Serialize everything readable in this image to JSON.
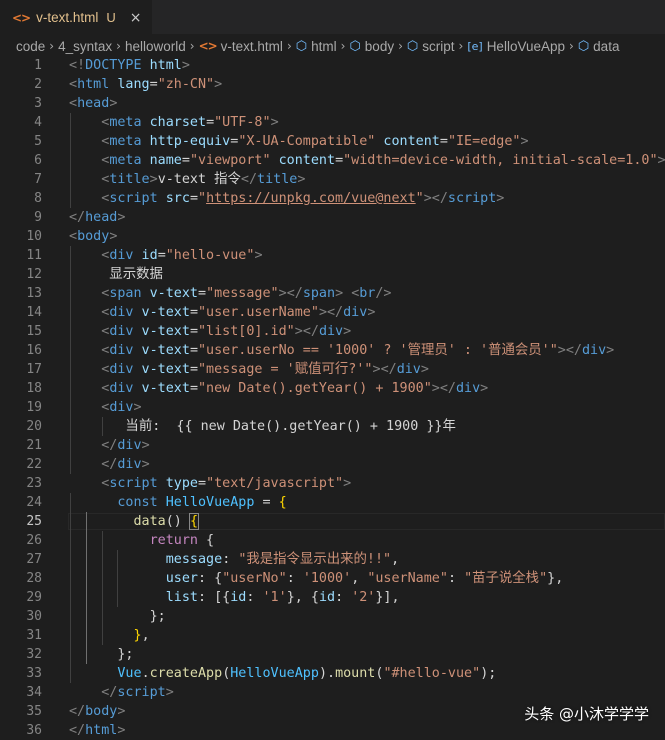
{
  "tab": {
    "icon": "html-file-icon",
    "title": "v-text.html",
    "badge": "U",
    "close": "×"
  },
  "breadcrumb": [
    {
      "label": "code",
      "icon": null
    },
    {
      "label": "4_syntax",
      "icon": null
    },
    {
      "label": "helloworld",
      "icon": null
    },
    {
      "label": "v-text.html",
      "icon": "html-file-icon"
    },
    {
      "label": "html",
      "icon": "element-icon"
    },
    {
      "label": "body",
      "icon": "element-icon"
    },
    {
      "label": "script",
      "icon": "element-icon"
    },
    {
      "label": "HelloVueApp",
      "icon": "variable-icon"
    },
    {
      "label": "data",
      "icon": "element-icon"
    }
  ],
  "editor": {
    "active_line": 25,
    "lines": [
      {
        "n": "1",
        "tokens": [
          [
            "punc",
            "<!"
          ],
          [
            "tag",
            "DOCTYPE"
          ],
          [
            "attr",
            " html"
          ],
          [
            "punc",
            ">"
          ]
        ]
      },
      {
        "n": "2",
        "tokens": [
          [
            "punc",
            "<"
          ],
          [
            "tag",
            "html"
          ],
          [
            "attr",
            " lang"
          ],
          [
            "txt",
            "="
          ],
          [
            "str",
            "\"zh-CN\""
          ],
          [
            "punc",
            ">"
          ]
        ]
      },
      {
        "n": "3",
        "tokens": [
          [
            "punc",
            "<"
          ],
          [
            "tag",
            "head"
          ],
          [
            "punc",
            ">"
          ]
        ]
      },
      {
        "n": "4",
        "tokens": [
          [
            "txt",
            "    "
          ],
          [
            "punc",
            "<"
          ],
          [
            "tag",
            "meta"
          ],
          [
            "attr",
            " charset"
          ],
          [
            "txt",
            "="
          ],
          [
            "str",
            "\"UTF-8\""
          ],
          [
            "punc",
            ">"
          ]
        ]
      },
      {
        "n": "5",
        "tokens": [
          [
            "txt",
            "    "
          ],
          [
            "punc",
            "<"
          ],
          [
            "tag",
            "meta"
          ],
          [
            "attr",
            " http-equiv"
          ],
          [
            "txt",
            "="
          ],
          [
            "str",
            "\"X-UA-Compatible\""
          ],
          [
            "attr",
            " content"
          ],
          [
            "txt",
            "="
          ],
          [
            "str",
            "\"IE=edge\""
          ],
          [
            "punc",
            ">"
          ]
        ]
      },
      {
        "n": "6",
        "tokens": [
          [
            "txt",
            "    "
          ],
          [
            "punc",
            "<"
          ],
          [
            "tag",
            "meta"
          ],
          [
            "attr",
            " name"
          ],
          [
            "txt",
            "="
          ],
          [
            "str",
            "\"viewport\""
          ],
          [
            "attr",
            " content"
          ],
          [
            "txt",
            "="
          ],
          [
            "str",
            "\"width=device-width, initial-scale=1.0\""
          ],
          [
            "punc",
            ">"
          ]
        ]
      },
      {
        "n": "7",
        "tokens": [
          [
            "txt",
            "    "
          ],
          [
            "punc",
            "<"
          ],
          [
            "tag",
            "title"
          ],
          [
            "punc",
            ">"
          ],
          [
            "txt",
            "v-text 指令"
          ],
          [
            "punc",
            "</"
          ],
          [
            "tag",
            "title"
          ],
          [
            "punc",
            ">"
          ]
        ]
      },
      {
        "n": "8",
        "tokens": [
          [
            "txt",
            "    "
          ],
          [
            "punc",
            "<"
          ],
          [
            "tag",
            "script"
          ],
          [
            "attr",
            " src"
          ],
          [
            "txt",
            "="
          ],
          [
            "str",
            "\""
          ],
          [
            "url",
            "https://unpkg.com/vue@next"
          ],
          [
            "str",
            "\""
          ],
          [
            "punc",
            ">"
          ],
          [
            "punc",
            "</"
          ],
          [
            "tag",
            "script"
          ],
          [
            "punc",
            ">"
          ]
        ]
      },
      {
        "n": "9",
        "tokens": [
          [
            "punc",
            "</"
          ],
          [
            "tag",
            "head"
          ],
          [
            "punc",
            ">"
          ]
        ]
      },
      {
        "n": "10",
        "tokens": [
          [
            "punc",
            "<"
          ],
          [
            "tag",
            "body"
          ],
          [
            "punc",
            ">"
          ]
        ]
      },
      {
        "n": "11",
        "tokens": [
          [
            "txt",
            "    "
          ],
          [
            "punc",
            "<"
          ],
          [
            "tag",
            "div"
          ],
          [
            "attr",
            " id"
          ],
          [
            "txt",
            "="
          ],
          [
            "str",
            "\"hello-vue\""
          ],
          [
            "punc",
            ">"
          ]
        ]
      },
      {
        "n": "12",
        "tokens": [
          [
            "txt",
            "     显示数据"
          ]
        ]
      },
      {
        "n": "13",
        "tokens": [
          [
            "txt",
            "    "
          ],
          [
            "punc",
            "<"
          ],
          [
            "tag",
            "span"
          ],
          [
            "attr",
            " v-text"
          ],
          [
            "txt",
            "="
          ],
          [
            "str",
            "\"message\""
          ],
          [
            "punc",
            ">"
          ],
          [
            "punc",
            "</"
          ],
          [
            "tag",
            "span"
          ],
          [
            "punc",
            ">"
          ],
          [
            "txt",
            " "
          ],
          [
            "punc",
            "<"
          ],
          [
            "tag",
            "br"
          ],
          [
            "punc",
            "/>"
          ]
        ]
      },
      {
        "n": "14",
        "tokens": [
          [
            "txt",
            "    "
          ],
          [
            "punc",
            "<"
          ],
          [
            "tag",
            "div"
          ],
          [
            "attr",
            " v-text"
          ],
          [
            "txt",
            "="
          ],
          [
            "str",
            "\"user.userName\""
          ],
          [
            "punc",
            ">"
          ],
          [
            "punc",
            "</"
          ],
          [
            "tag",
            "div"
          ],
          [
            "punc",
            ">"
          ]
        ]
      },
      {
        "n": "15",
        "tokens": [
          [
            "txt",
            "    "
          ],
          [
            "punc",
            "<"
          ],
          [
            "tag",
            "div"
          ],
          [
            "attr",
            " v-text"
          ],
          [
            "txt",
            "="
          ],
          [
            "str",
            "\"list[0].id\""
          ],
          [
            "punc",
            ">"
          ],
          [
            "punc",
            "</"
          ],
          [
            "tag",
            "div"
          ],
          [
            "punc",
            ">"
          ]
        ]
      },
      {
        "n": "16",
        "tokens": [
          [
            "txt",
            "    "
          ],
          [
            "punc",
            "<"
          ],
          [
            "tag",
            "div"
          ],
          [
            "attr",
            " v-text"
          ],
          [
            "txt",
            "="
          ],
          [
            "str",
            "\"user.userNo == '1000' ? '管理员' : '普通会员'\""
          ],
          [
            "punc",
            ">"
          ],
          [
            "punc",
            "</"
          ],
          [
            "tag",
            "div"
          ],
          [
            "punc",
            ">"
          ]
        ]
      },
      {
        "n": "17",
        "tokens": [
          [
            "txt",
            "    "
          ],
          [
            "punc",
            "<"
          ],
          [
            "tag",
            "div"
          ],
          [
            "attr",
            " v-text"
          ],
          [
            "txt",
            "="
          ],
          [
            "str",
            "\"message = '赋值可行?'\""
          ],
          [
            "punc",
            ">"
          ],
          [
            "punc",
            "</"
          ],
          [
            "tag",
            "div"
          ],
          [
            "punc",
            ">"
          ]
        ]
      },
      {
        "n": "18",
        "tokens": [
          [
            "txt",
            "    "
          ],
          [
            "punc",
            "<"
          ],
          [
            "tag",
            "div"
          ],
          [
            "attr",
            " v-text"
          ],
          [
            "txt",
            "="
          ],
          [
            "str",
            "\"new Date().getYear() + 1900\""
          ],
          [
            "punc",
            ">"
          ],
          [
            "punc",
            "</"
          ],
          [
            "tag",
            "div"
          ],
          [
            "punc",
            ">"
          ]
        ]
      },
      {
        "n": "19",
        "tokens": [
          [
            "txt",
            "    "
          ],
          [
            "punc",
            "<"
          ],
          [
            "tag",
            "div"
          ],
          [
            "punc",
            ">"
          ]
        ]
      },
      {
        "n": "20",
        "tokens": [
          [
            "txt",
            "       当前:  {{ new Date().getYear() + 1900 }}年"
          ]
        ]
      },
      {
        "n": "21",
        "tokens": [
          [
            "txt",
            "    "
          ],
          [
            "punc",
            "</"
          ],
          [
            "tag",
            "div"
          ],
          [
            "punc",
            ">"
          ]
        ]
      },
      {
        "n": "22",
        "tokens": [
          [
            "txt",
            "    "
          ],
          [
            "punc",
            "</"
          ],
          [
            "tag",
            "div"
          ],
          [
            "punc",
            ">"
          ]
        ]
      },
      {
        "n": "23",
        "tokens": [
          [
            "txt",
            "    "
          ],
          [
            "punc",
            "<"
          ],
          [
            "tag",
            "script"
          ],
          [
            "attr",
            " type"
          ],
          [
            "txt",
            "="
          ],
          [
            "str",
            "\"text/javascript\""
          ],
          [
            "punc",
            ">"
          ]
        ]
      },
      {
        "n": "24",
        "tokens": [
          [
            "txt",
            "      "
          ],
          [
            "kw",
            "const"
          ],
          [
            "txt",
            " "
          ],
          [
            "var",
            "HelloVueApp"
          ],
          [
            "txt",
            " = "
          ],
          [
            "br",
            "{"
          ]
        ]
      },
      {
        "n": "25",
        "tokens": [
          [
            "txt",
            "        "
          ],
          [
            "fn",
            "data"
          ],
          [
            "txt",
            "() "
          ],
          [
            "box",
            "{"
          ]
        ]
      },
      {
        "n": "26",
        "tokens": [
          [
            "txt",
            "          "
          ],
          [
            "ctl",
            "return"
          ],
          [
            "txt",
            " {"
          ]
        ]
      },
      {
        "n": "27",
        "tokens": [
          [
            "txt",
            "            "
          ],
          [
            "prop",
            "message"
          ],
          [
            "txt",
            ": "
          ],
          [
            "str",
            "\"我是指令显示出来的!!\""
          ],
          [
            "txt",
            ","
          ]
        ]
      },
      {
        "n": "28",
        "tokens": [
          [
            "txt",
            "            "
          ],
          [
            "prop",
            "user"
          ],
          [
            "txt",
            ": {"
          ],
          [
            "str",
            "\"userNo\""
          ],
          [
            "txt",
            ": "
          ],
          [
            "str",
            "'1000'"
          ],
          [
            "txt",
            ", "
          ],
          [
            "str",
            "\"userName\""
          ],
          [
            "txt",
            ": "
          ],
          [
            "str",
            "\"苗子说全栈\""
          ],
          [
            "txt",
            "},"
          ]
        ]
      },
      {
        "n": "29",
        "tokens": [
          [
            "txt",
            "            "
          ],
          [
            "prop",
            "list"
          ],
          [
            "txt",
            ": [{"
          ],
          [
            "prop",
            "id"
          ],
          [
            "txt",
            ": "
          ],
          [
            "str",
            "'1'"
          ],
          [
            "txt",
            "}, {"
          ],
          [
            "prop",
            "id"
          ],
          [
            "txt",
            ": "
          ],
          [
            "str",
            "'2'"
          ],
          [
            "txt",
            "}],"
          ]
        ]
      },
      {
        "n": "30",
        "tokens": [
          [
            "txt",
            "          };"
          ]
        ]
      },
      {
        "n": "31",
        "tokens": [
          [
            "txt",
            "        "
          ],
          [
            "br",
            "}"
          ],
          [
            "txt",
            ","
          ]
        ]
      },
      {
        "n": "32",
        "tokens": [
          [
            "txt",
            "      };"
          ]
        ]
      },
      {
        "n": "33",
        "tokens": [
          [
            "txt",
            "      "
          ],
          [
            "var",
            "Vue"
          ],
          [
            "txt",
            "."
          ],
          [
            "fn",
            "createApp"
          ],
          [
            "txt",
            "("
          ],
          [
            "var",
            "HelloVueApp"
          ],
          [
            "txt",
            ")."
          ],
          [
            "fn",
            "mount"
          ],
          [
            "txt",
            "("
          ],
          [
            "str",
            "\"#hello-vue\""
          ],
          [
            "txt",
            ");"
          ]
        ]
      },
      {
        "n": "34",
        "tokens": [
          [
            "txt",
            "    "
          ],
          [
            "punc",
            "</"
          ],
          [
            "tag",
            "script"
          ],
          [
            "punc",
            ">"
          ]
        ]
      },
      {
        "n": "35",
        "tokens": [
          [
            "punc",
            "</"
          ],
          [
            "tag",
            "body"
          ],
          [
            "punc",
            ">"
          ]
        ]
      },
      {
        "n": "36",
        "tokens": [
          [
            "punc",
            "</"
          ],
          [
            "tag",
            "html"
          ],
          [
            "punc",
            ">"
          ]
        ]
      }
    ]
  },
  "watermark": {
    "text": "头条 @小沐学学学"
  }
}
